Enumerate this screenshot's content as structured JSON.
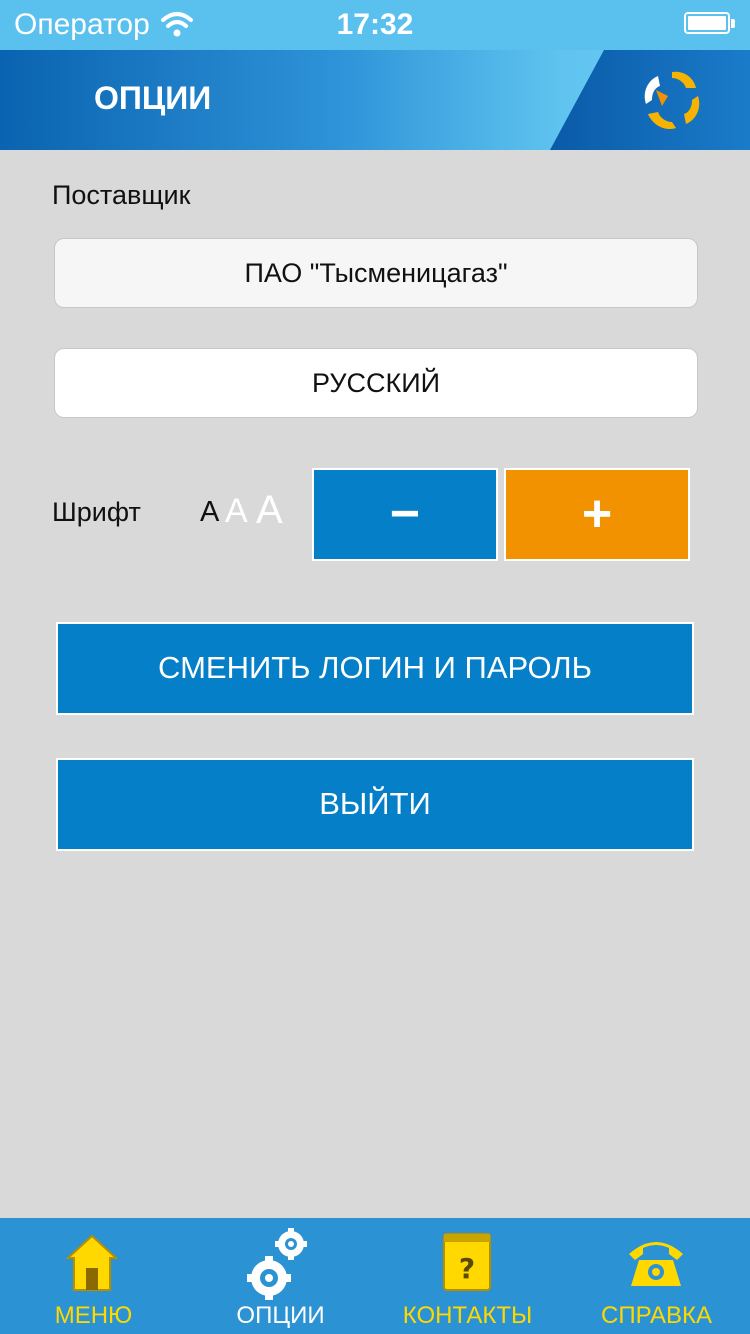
{
  "status_bar": {
    "carrier": "Оператор",
    "time": "17:32"
  },
  "header": {
    "title": "ОПЦИИ"
  },
  "settings": {
    "supplier_label": "Поставщик",
    "supplier_value": "ПАО \"Тысменицагаз\"",
    "language_value": "РУССКИЙ",
    "font_label": "Шрифт",
    "font_samples": [
      "A",
      "A",
      "A"
    ],
    "font_decrease_label": "−",
    "font_increase_label": "+",
    "change_credentials_label": "СМЕНИТЬ ЛОГИН И ПАРОЛЬ",
    "logout_label": "ВЫЙТИ"
  },
  "tab_bar": {
    "items": [
      {
        "label": "МЕНЮ",
        "icon": "home-icon",
        "active": false
      },
      {
        "label": "ОПЦИИ",
        "icon": "gears-icon",
        "active": true
      },
      {
        "label": "КОНТАКТЫ",
        "icon": "book-icon",
        "active": false
      },
      {
        "label": "СПРАВКА",
        "icon": "phone-icon",
        "active": false
      }
    ]
  },
  "colors": {
    "primary_blue": "#0580c8",
    "accent_orange": "#f39200",
    "tab_inactive": "#ffd800",
    "background": "#d9d9d9"
  }
}
